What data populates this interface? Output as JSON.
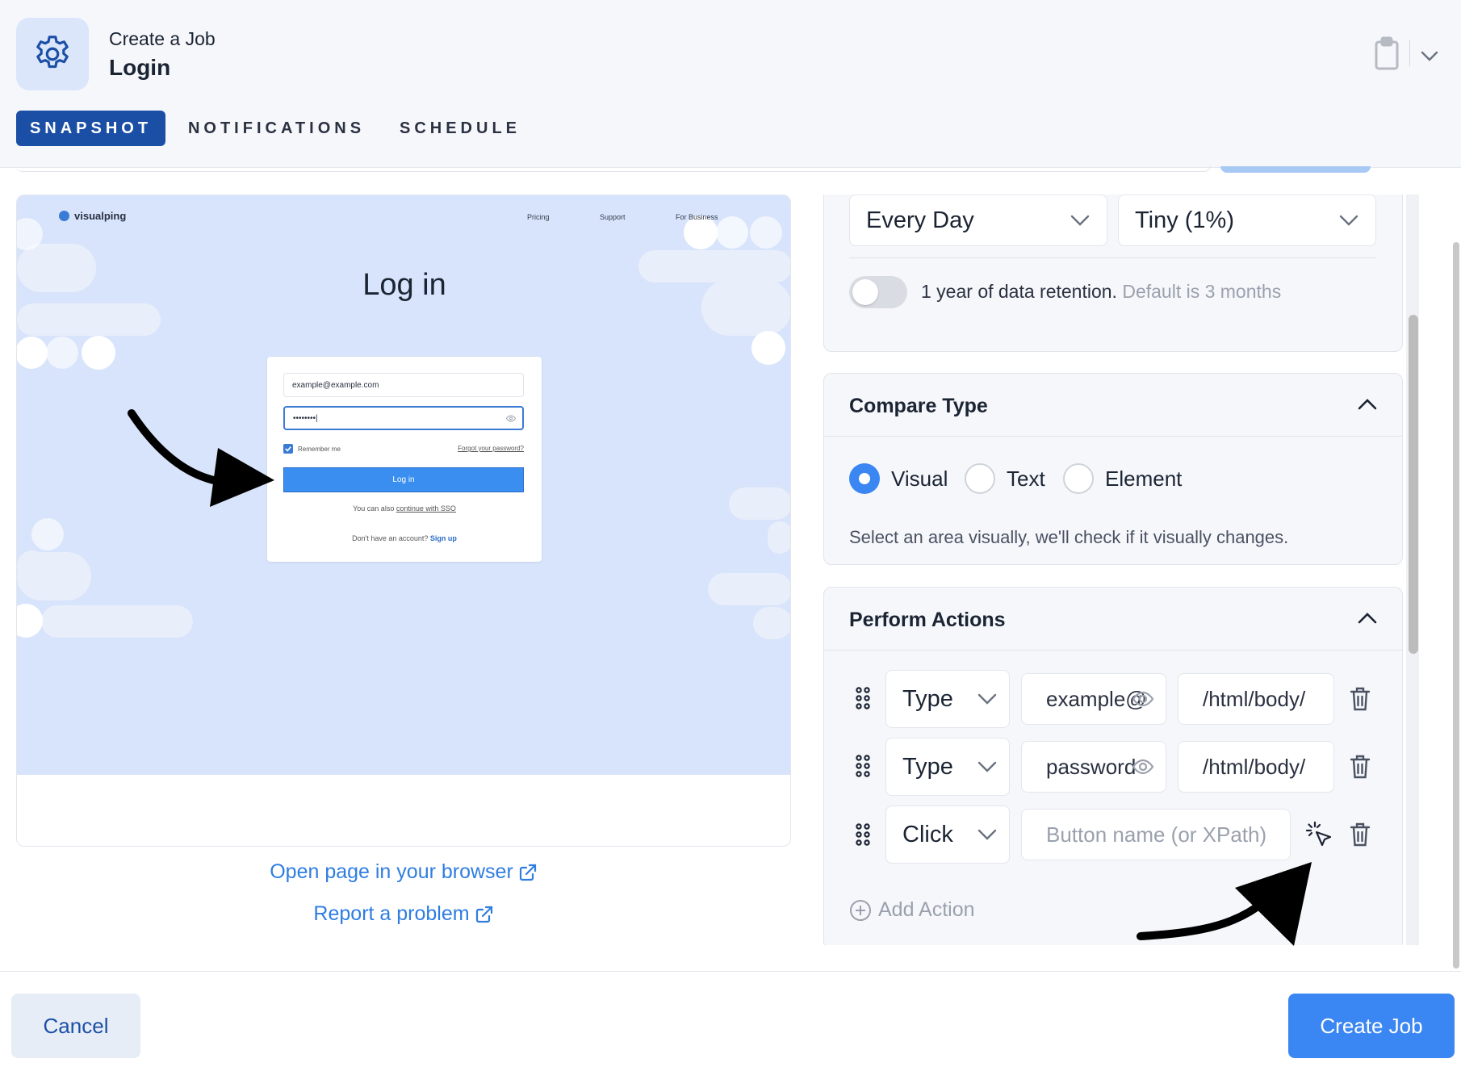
{
  "header": {
    "caption": "Create a Job",
    "title": "Login"
  },
  "tabs": [
    {
      "label": "SNAPSHOT",
      "active": true
    },
    {
      "label": "NOTIFICATIONS",
      "active": false
    },
    {
      "label": "SCHEDULE",
      "active": false
    }
  ],
  "preview": {
    "logo": "visualping",
    "nav": [
      "Pricing",
      "Support",
      "For Business"
    ],
    "heading": "Log in",
    "email_value": "example@example.com",
    "password_value": "••••••••|",
    "remember_label": "Remember me",
    "forgot_label": "Forgot your password?",
    "login_button": "Log in",
    "sso_prefix": "You can also ",
    "sso_link": "continue with SSO",
    "signup_prefix": "Don't have an account? ",
    "signup_link": "Sign up"
  },
  "links": {
    "open_page": "Open page in your browser",
    "report": "Report a problem"
  },
  "settings": {
    "frequency": "Every Day",
    "sensitivity": "Tiny (1%)",
    "retention_label": "1 year of data retention.",
    "retention_default": "Default is 3 months",
    "retention_enabled": false
  },
  "compare_type": {
    "title": "Compare Type",
    "options": [
      "Visual",
      "Text",
      "Element"
    ],
    "selected": "Visual",
    "description": "Select an area visually, we'll check if it visually changes."
  },
  "perform_actions": {
    "title": "Perform Actions",
    "actions": [
      {
        "type": "Type",
        "value": "example@",
        "xpath": "/html/body/"
      },
      {
        "type": "Type",
        "value": "password",
        "xpath": "/html/body/"
      },
      {
        "type": "Click",
        "placeholder": "Button name (or XPath)"
      }
    ],
    "add_label": "Add Action"
  },
  "footer": {
    "cancel": "Cancel",
    "create": "Create Job"
  },
  "colors": {
    "primary": "#3a86f2",
    "tab_active": "#1b4fa6",
    "link": "#2f7de1"
  }
}
